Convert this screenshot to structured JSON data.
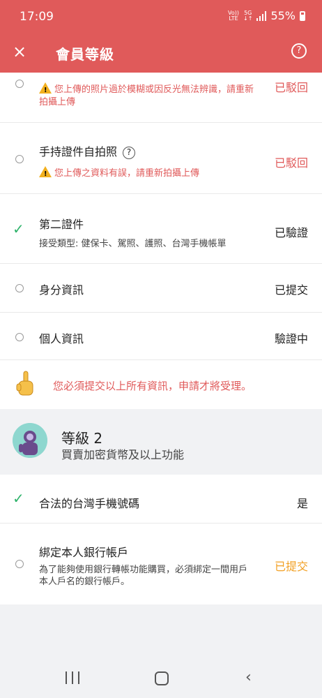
{
  "status_bar": {
    "time": "17:09",
    "volte": "Vo)) LTE",
    "net": "5G",
    "battery_pct": "55%"
  },
  "header": {
    "close_icon": "×",
    "title": "會員等級",
    "help_icon": "?"
  },
  "items_level1": [
    {
      "title": "",
      "warning": "您上傳的照片過於模糊或因反光無法辨識，請重新拍攝上傳",
      "status": "已駁回"
    },
    {
      "title": "手持證件自拍照",
      "warning": "您上傳之資料有誤，請重新拍攝上傳",
      "status": "已駁回"
    },
    {
      "title": "第二證件",
      "subtitle": "接受類型: 健保卡、駕照、護照、台灣手機帳單",
      "status": "已驗證"
    },
    {
      "title": "身分資訊",
      "status": "已提交"
    },
    {
      "title": "個人資訊",
      "status": "驗證中"
    }
  ],
  "notice": {
    "text": "您必須提交以上所有資訊，申請才將受理。"
  },
  "level2": {
    "title": "等級 2",
    "subtitle": "買賣加密貨幣及以上功能"
  },
  "items_level2": [
    {
      "title": "合法的台灣手機號碼",
      "status": "是"
    },
    {
      "title": "綁定本人銀行帳戶",
      "subtitle": "為了能夠使用銀行轉帳功能購買，必須綁定一間用戶本人戶名的銀行帳戶。",
      "status": "已提交"
    }
  ],
  "colors": {
    "brand": "#e05a5a",
    "success": "#2fb36b",
    "pending": "#f2a024"
  }
}
